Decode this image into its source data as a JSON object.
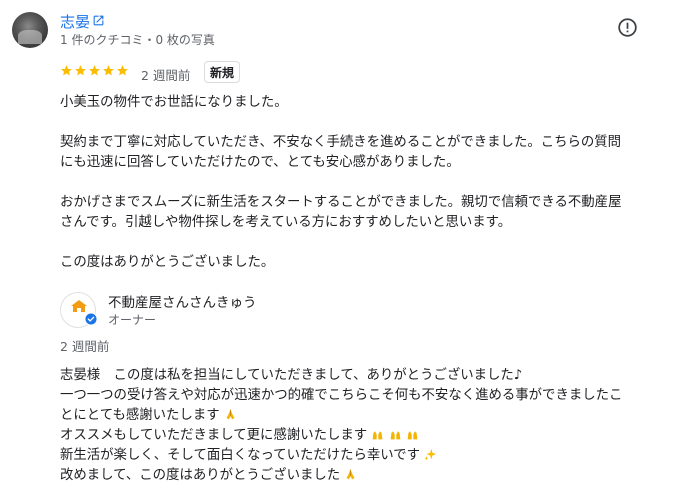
{
  "reviewer": {
    "name": "志晏",
    "meta": "1 件のクチコミ・0 枚の写真"
  },
  "review": {
    "rating": 5,
    "date": "2 週間前",
    "badge": "新規",
    "paragraphs": [
      "小美玉の物件でお世話になりました。",
      "契約まで丁寧に対応していただき、不安なく手続きを進めることができました。こちらの質問",
      "にも迅速に回答していただけたので、とても安心感がありました。",
      "おかげさまでスムーズに新生活をスタートすることができました。親切で信頼できる不動産屋",
      "さんです。引越しや物件探しを考えている方におすすめしたいと思います。",
      "この度はありがとうございました。"
    ]
  },
  "owner": {
    "name": "不動産屋さんさんきゅう",
    "role": "オーナー",
    "logo_text": "不動産屋さんさんきゅう",
    "date": "2 週間前",
    "reply_lines": [
      "志晏様　この度は私を担当にしていただきまして、ありがとうございました♪",
      "一つ一つの受け答えや対応が迅速かつ的確でこちらこそ何も不安なく進める事ができましたこ",
      "とにとても感謝いたします",
      "オススメもしていただきまして更に感謝いたします",
      "新生活が楽しく、そして面白くなっていただけたら幸いです",
      "改めまして、この度はありがとうございました"
    ]
  },
  "colors": {
    "link": "#1a73e8",
    "star": "#fbbc04",
    "secondary_text": "#5f6368"
  },
  "icons": {
    "external": "open-in-new-icon",
    "report": "report-icon",
    "verified": "verified-badge-icon",
    "emoji_pray": "folded-hands-emoji",
    "emoji_raise": "raising-hands-emoji",
    "emoji_sparkles": "sparkles-emoji"
  }
}
